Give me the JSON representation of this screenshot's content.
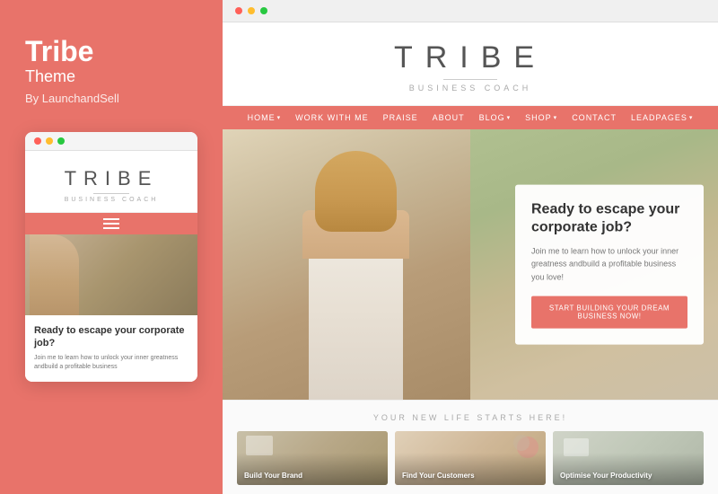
{
  "leftPanel": {
    "themeTitle": "Tribe",
    "themeSubtitle": "Theme",
    "author": "By LaunchandSell"
  },
  "mobileBrowser": {
    "dots": [
      "red",
      "yellow",
      "green"
    ]
  },
  "mobileSite": {
    "logo": "TRIBE",
    "tagline": "BUSINESS COACH",
    "headline": "Ready to escape your corporate job?",
    "bodyText": "Join me to learn how to unlock your inner greatness andbuild a profitable business"
  },
  "desktopBrowser": {
    "dots": [
      "red",
      "yellow",
      "green"
    ]
  },
  "desktopSite": {
    "logo": "TRIBE",
    "tagline": "BUSINESS COACH",
    "nav": [
      {
        "label": "HOME",
        "hasArrow": true
      },
      {
        "label": "WORK WITH ME",
        "hasArrow": false
      },
      {
        "label": "PRAISE",
        "hasArrow": false
      },
      {
        "label": "ABOUT",
        "hasArrow": false
      },
      {
        "label": "BLOG",
        "hasArrow": true
      },
      {
        "label": "SHOP",
        "hasArrow": true
      },
      {
        "label": "CONTACT",
        "hasArrow": false
      },
      {
        "label": "LEADPAGES",
        "hasArrow": true
      }
    ],
    "hero": {
      "headline": "Ready to escape your corporate job?",
      "body": "Join me to learn how to unlock your inner greatness andbuild a profitable business you love!",
      "ctaButton": "Start building your dream business now!"
    },
    "sectionLabel": "YOUR NEW LIFE STARTS HERE!",
    "featureCards": [
      {
        "label": "Build Your Brand",
        "bgClass": "feature-card-bg-1"
      },
      {
        "label": "Find Your Customers",
        "bgClass": "feature-card-bg-2"
      },
      {
        "label": "Optimise Your Productivity",
        "bgClass": "feature-card-bg-3"
      }
    ]
  },
  "colors": {
    "brand": "#e8736a",
    "white": "#ffffff",
    "darkText": "#333333",
    "lightText": "#777777"
  }
}
